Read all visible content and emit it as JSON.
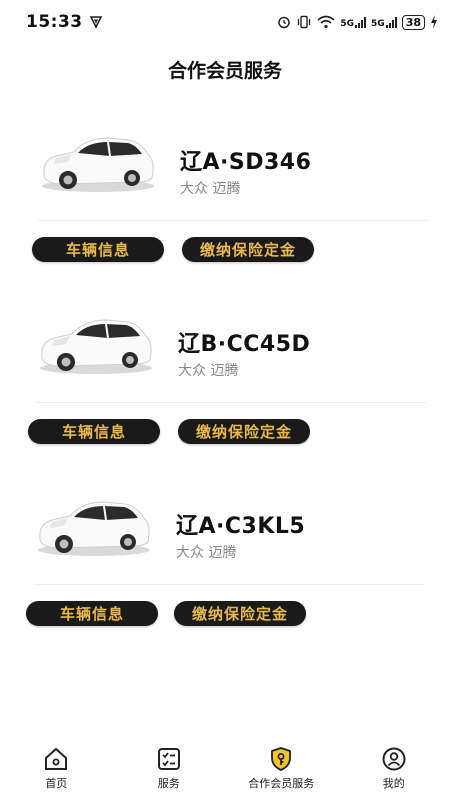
{
  "status": {
    "time": "15:33",
    "network_1": "5G",
    "network_2": "5G",
    "battery": "38"
  },
  "page": {
    "title": "合作会员服务"
  },
  "cars": [
    {
      "plate": "辽A·SD346",
      "model": "大众  迈腾",
      "info_label": "车辆信息",
      "deposit_label": "缴纳保险定金"
    },
    {
      "plate": "辽B·CC45D",
      "model": "大众  迈腾",
      "info_label": "车辆信息",
      "deposit_label": "缴纳保险定金"
    },
    {
      "plate": "辽A·C3KL5",
      "model": "大众  迈腾",
      "info_label": "车辆信息",
      "deposit_label": "缴纳保险定金"
    }
  ],
  "tabbar": {
    "active": "合作会员服务",
    "items": [
      {
        "label": "首页",
        "icon": "home-icon"
      },
      {
        "label": "服务",
        "icon": "service-list-icon"
      },
      {
        "label": "合作会员服务",
        "icon": "shield-key-icon"
      },
      {
        "label": "我的",
        "icon": "user-icon"
      }
    ]
  },
  "colors": {
    "pill_bg": "#1a1a1a",
    "pill_text": "#e8b84a",
    "active_tab": "#f2c230"
  }
}
